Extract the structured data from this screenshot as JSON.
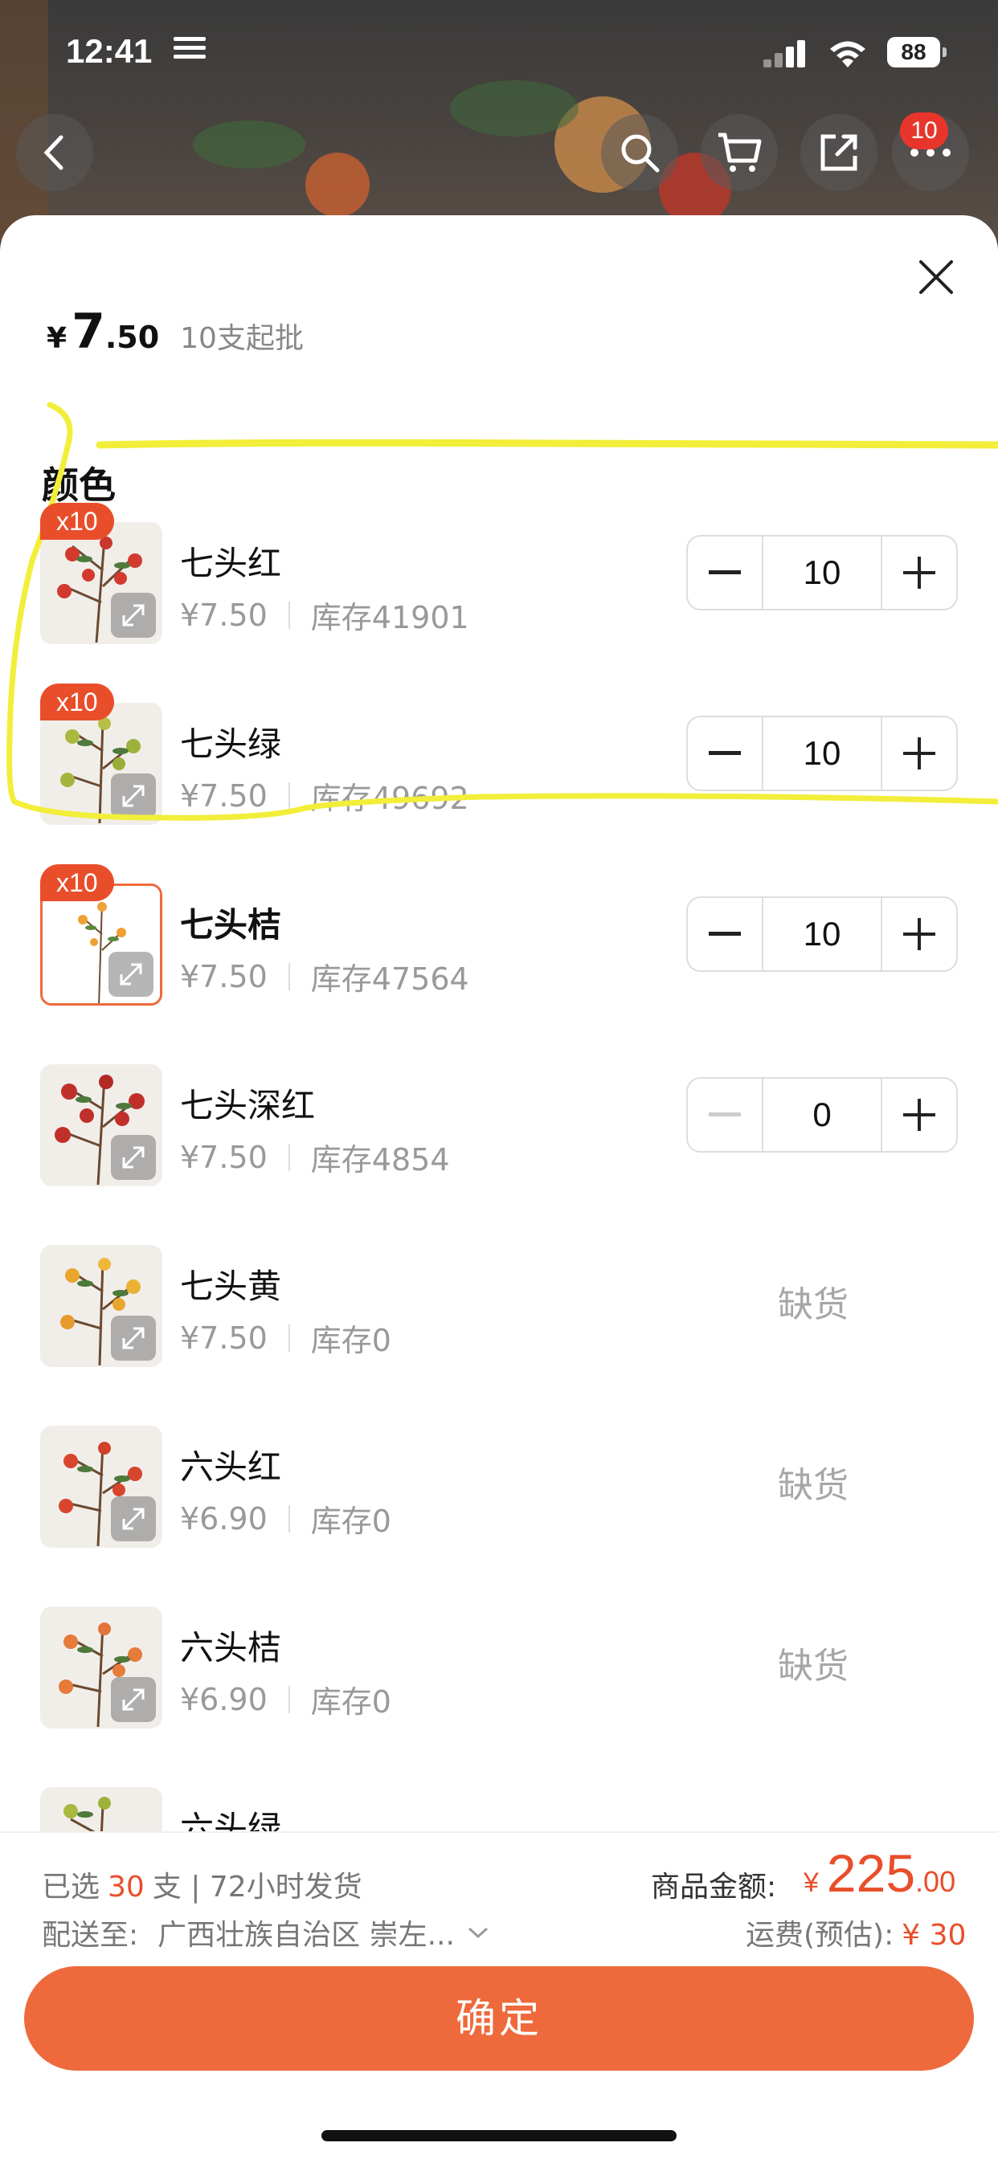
{
  "status_bar": {
    "time": "12:41",
    "battery": "88"
  },
  "nav": {
    "cart_count": "10"
  },
  "header": {
    "price_symbol": "¥",
    "price_int": "7",
    "price_dec": ".50",
    "moq": "10支起批"
  },
  "section_title": "颜色",
  "skus": [
    {
      "name": "七头红",
      "price": "¥7.50",
      "stock": "库存41901",
      "qty": "10",
      "badge": "x10",
      "state": "stepper",
      "selected": false
    },
    {
      "name": "七头绿",
      "price": "¥7.50",
      "stock": "库存49692",
      "qty": "10",
      "badge": "x10",
      "state": "stepper",
      "selected": false
    },
    {
      "name": "七头桔",
      "price": "¥7.50",
      "stock": "库存47564",
      "qty": "10",
      "badge": "x10",
      "state": "stepper",
      "selected": true
    },
    {
      "name": "七头深红",
      "price": "¥7.50",
      "stock": "库存4854",
      "qty": "0",
      "badge": "",
      "state": "stepper",
      "selected": false
    },
    {
      "name": "七头黄",
      "price": "¥7.50",
      "stock": "库存0",
      "status": "缺货",
      "state": "soldout"
    },
    {
      "name": "六头红",
      "price": "¥6.90",
      "stock": "库存0",
      "status": "缺货",
      "state": "soldout"
    },
    {
      "name": "六头桔",
      "price": "¥6.90",
      "stock": "库存0",
      "status": "缺货",
      "state": "soldout"
    },
    {
      "name": "六头绿",
      "state": "partial"
    }
  ],
  "footer": {
    "selected_prefix": "已选",
    "selected_count": "30",
    "selected_suffix": "支 | 72小时发货",
    "ship_label": "配送至:",
    "ship_address": "广西壮族自治区 崇左...",
    "total_label": "商品金额:",
    "total_symbol": "¥",
    "total_int": "225",
    "total_dec": ".00",
    "freight_label": "运费(预估):",
    "freight_value": "¥ 30",
    "confirm": "确定"
  },
  "colors": {
    "accent": "#ee6a3c",
    "badge": "#e94e2b",
    "annotation": "#f2ee3a"
  }
}
